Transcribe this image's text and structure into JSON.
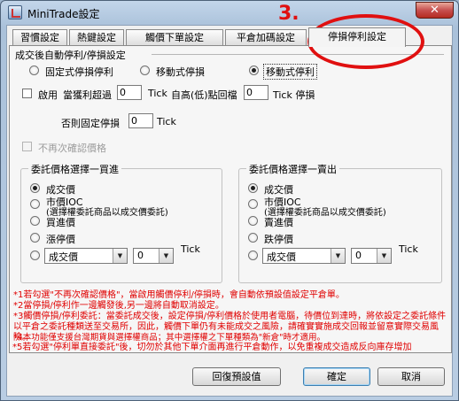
{
  "window": {
    "title": "MiniTrade設定",
    "close_glyph": "✕"
  },
  "annotation": {
    "number": "3."
  },
  "tabs": [
    {
      "label": "習慣設定",
      "active": false
    },
    {
      "label": "熱鍵設定",
      "active": false
    },
    {
      "label": "觸價下單設定",
      "active": false
    },
    {
      "label": "平倉加碼設定",
      "active": false
    },
    {
      "label": "停損停利設定",
      "active": true
    }
  ],
  "auto_setting": {
    "section_title": "成交後自動停利/停損設定",
    "modes": [
      {
        "label": "固定式停損停利",
        "selected": false
      },
      {
        "label": "移動式停損",
        "selected": false
      },
      {
        "label": "移動式停利",
        "selected": true
      }
    ],
    "enable_label": "啟用",
    "profit_text": "當獲利超過",
    "profit_value": "0",
    "tick1": "Tick",
    "retrace_text": "自高(低)點回檔",
    "retrace_value": "0",
    "tick_stop": "Tick 停損",
    "else_text": "否則固定停損",
    "else_value": "0",
    "tick3": "Tick",
    "no_confirm_label": "不再次確認價格"
  },
  "buy_group": {
    "title": "委託價格選擇一買進",
    "options": [
      {
        "label": "成交價",
        "selected": true
      },
      {
        "label": "市價IOC",
        "selected": false
      },
      {
        "label": "(選擇權委託商品以成交價委託)",
        "selected": false
      },
      {
        "label": "買進價",
        "selected": false
      },
      {
        "label": "漲停價",
        "selected": false
      }
    ],
    "combo_label": "成交價",
    "offset_value": "0",
    "tick": "Tick"
  },
  "sell_group": {
    "title": "委託價格選擇一賣出",
    "options": [
      {
        "label": "成交價",
        "selected": true
      },
      {
        "label": "市價IOC",
        "selected": false
      },
      {
        "label": "(選擇權委託商品以成交價委託)",
        "selected": false
      },
      {
        "label": "賣進價",
        "selected": false
      },
      {
        "label": "跌停價",
        "selected": false
      }
    ],
    "combo_label": "成交價",
    "offset_value": "0",
    "tick": "Tick"
  },
  "notes": [
    "*1若勾選\"不再次確認價格\"，當啟用觸價停利/停損時，會自動依預設值設定平倉單。",
    "*2當停損/停利作一邊觸發後,另一邊將自動取消設定。",
    "*3觸價停損/停利委託：當委託成交後，設定停損/停利價格於使用者電腦，待價位到達時，將依設定之委託條件以平倉之委託種類送至交易所，因此，觸價下單仍有未能成交之風險，請確實實施成交回報並留意實際交易風險。",
    "*4本功能僅支援台灣期貨與選擇權商品；其中選擇權之下單種類為\"新倉\"時才適用。",
    "*5若勾選\"停利單直接委託\"後，切勿於其他下單介面再進行平倉動作，以免重複成交造成反向庫存增加"
  ],
  "buttons": {
    "restore": "回復預設值",
    "ok": "確定",
    "cancel": "取消"
  }
}
